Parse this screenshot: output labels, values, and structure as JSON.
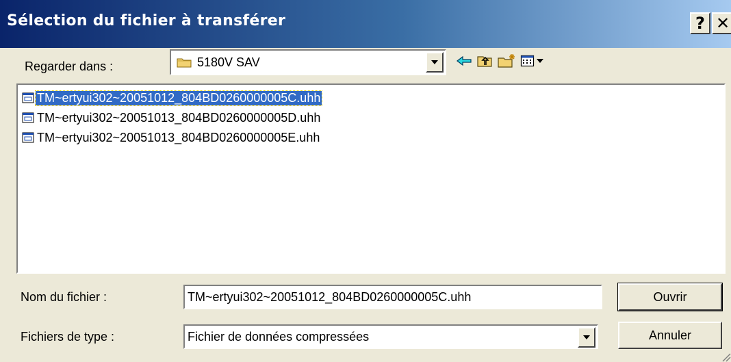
{
  "window": {
    "title": "Sélection du fichier à transférer",
    "help_label": "?",
    "close_label": "✕"
  },
  "look_in": {
    "label": "Regarder dans :",
    "value": "5180V SAV"
  },
  "toolbar": {
    "back_icon": "back-arrow-icon",
    "up_icon": "up-folder-icon",
    "new_folder_icon": "new-folder-icon",
    "view_icon": "view-menu-icon"
  },
  "files": [
    {
      "name": "TM~ertyui302~20051012_804BD0260000005C.uhh",
      "selected": true
    },
    {
      "name": "TM~ertyui302~20051013_804BD0260000005D.uhh",
      "selected": false
    },
    {
      "name": "TM~ertyui302~20051013_804BD0260000005E.uhh",
      "selected": false
    }
  ],
  "filename": {
    "label": "Nom du fichier :",
    "value": "TM~ertyui302~20051012_804BD0260000005C.uhh"
  },
  "filetype": {
    "label": "Fichiers de type :",
    "value": "Fichier de données compressées"
  },
  "buttons": {
    "open": "Ouvrir",
    "cancel": "Annuler"
  },
  "colors": {
    "selection": "#316ac5",
    "titlebar_start": "#0a246a",
    "face": "#ece9d8"
  }
}
